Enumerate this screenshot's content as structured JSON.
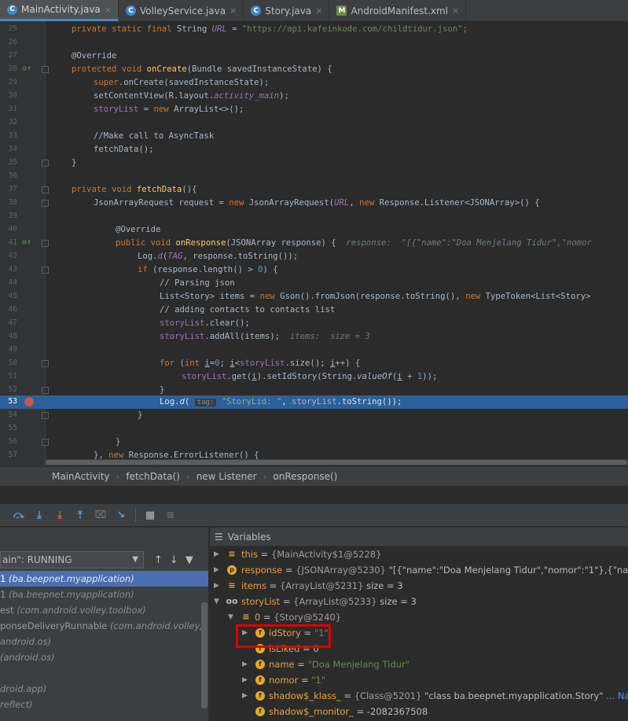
{
  "tabs": [
    {
      "label": "MainActivity.java",
      "icon": "java-class-icon",
      "active": true
    },
    {
      "label": "VolleyService.java",
      "icon": "java-class-icon",
      "active": false
    },
    {
      "label": "Story.java",
      "icon": "java-class-icon",
      "active": false
    },
    {
      "label": "AndroidManifest.xml",
      "icon": "xml-manifest-icon",
      "active": false
    }
  ],
  "code": {
    "line_numbers": [
      "25",
      "26",
      "27",
      "28",
      "29",
      "30",
      "31",
      "32",
      "33",
      "34",
      "35",
      "36",
      "37",
      "38",
      "39",
      "40",
      "41",
      "42",
      "43",
      "44",
      "45",
      "46",
      "47",
      "48",
      "49",
      "50",
      "51",
      "52",
      "53",
      "54",
      "55",
      "56",
      "57"
    ],
    "current_line": "53",
    "l25": {
      "a": "private static final ",
      "b": "String ",
      "c": "URL",
      "d": " = ",
      "e": "\"https://api.kafeinkode.com/childtidur.json\"",
      "f": ";"
    },
    "l27": "@Override",
    "l28": {
      "a": "protected void ",
      "b": "onCreate",
      "c": "(Bundle savedInstanceState) {"
    },
    "l29": {
      "a": "super",
      "b": ".onCreate(savedInstanceState);"
    },
    "l30": {
      "a": "setContentView(R.layout.",
      "b": "activity_main",
      "c": ");"
    },
    "l31": {
      "a": "storyList",
      "b": " = ",
      "c": "new ",
      "d": "ArrayList<>();"
    },
    "l33": "//Make call to AsyncTask",
    "l34": "fetchData();",
    "l35": "}",
    "l37": {
      "a": "private void ",
      "b": "fetchData",
      "c": "(){"
    },
    "l38": {
      "a": "JsonArrayRequest request = ",
      "b": "new ",
      "c": "JsonArrayRequest(",
      "d": "URL",
      "e": ", ",
      "f": "new ",
      "g": "Response.Listener<JSONArray>() {"
    },
    "l40": "@Override",
    "l41": {
      "a": "public void ",
      "b": "onResponse",
      "c": "(JSONArray response) {  ",
      "d": "response:  \"[{\"name\":\"Doa Menjelang Tidur\",\"nomor"
    },
    "l42": {
      "a": "Log.",
      "b": "d",
      "c": "(",
      "d": "TAG",
      "e": ", response.toString());"
    },
    "l43": {
      "a": "if ",
      "b": "(response.length() > ",
      "c": "0",
      "d": ") {"
    },
    "l44": "// Parsing json",
    "l45": {
      "a": "List<Story> items = ",
      "b": "new ",
      "c": "Gson().fromJson(response.toString(), ",
      "d": "new ",
      "e": "TypeToken<List<Story>"
    },
    "l46": "// adding contacts to contacts list",
    "l47": {
      "a": "storyList",
      "b": ".clear();"
    },
    "l48": {
      "a": "storyList",
      "b": ".addAll(items);  ",
      "c": "items:  size = 3"
    },
    "l50": {
      "a": "for ",
      "b": "(",
      "c": "int ",
      "d": "i",
      "e": "=",
      "f": "0",
      "g": "; ",
      "h": "i",
      "i": "<",
      "j": "storyList",
      "k": ".size(); ",
      "l": "i",
      "m": "++) {"
    },
    "l51": {
      "a": "storyList",
      "b": ".get(",
      "c": "i",
      "d": ").setIdStory(String.",
      "e": "valueOf",
      "f": "(",
      "g": "i",
      "h": " + ",
      "i": "1",
      "j": "));"
    },
    "l52": "}",
    "l53": {
      "a": "Log.",
      "b": "d",
      "c": "( ",
      "param": "tag:",
      "d": " \"StoryLid: \"",
      "e": ", ",
      "f": "storyList",
      "g": ".toString());"
    },
    "l54": "}",
    "l56": "}",
    "l57": {
      "a": "}, ",
      "b": "new ",
      "c": "Response.ErrorListener() {"
    }
  },
  "breadcrumb": [
    "MainActivity",
    "fetchData()",
    "new Listener",
    "onResponse()"
  ],
  "debug_toolbar": {
    "buttons": [
      "step-over-icon",
      "step-into-icon",
      "force-step-into-icon",
      "step-out-icon",
      "drop-frame-icon",
      "run-to-cursor-icon",
      "evaluate-expression-icon",
      "trace-icon"
    ]
  },
  "frames": {
    "thread": "ain\": RUNNING",
    "items": [
      {
        "name": "1",
        "pkg": "(ba.beepnet.myapplication)",
        "selected": true
      },
      {
        "name": "1",
        "pkg": "(ba.beepnet.myapplication)",
        "selected": false
      },
      {
        "name": "est",
        "pkg": "(com.android.volley.toolbox)",
        "selected": false
      },
      {
        "name": "ponseDeliveryRunnable",
        "pkg": "(com.android.volley)",
        "selected": false
      },
      {
        "name": "",
        "pkg": "android.os)",
        "selected": false
      },
      {
        "name": "",
        "pkg": "(android.os)",
        "selected": false
      },
      {
        "name": "",
        "pkg": "",
        "selected": false
      },
      {
        "name": "",
        "pkg": "droid.app)",
        "selected": false
      },
      {
        "name": "",
        "pkg": "reflect)",
        "selected": false
      },
      {
        "name": "",
        "pkg": "",
        "selected": false
      }
    ]
  },
  "variables": {
    "header": "Variables",
    "rows": [
      {
        "name": "this",
        "eq": " = ",
        "val": "{MainActivity$1@5228}",
        "extra": ""
      },
      {
        "name": "response",
        "eq": " = ",
        "val": "{JSONArray@5230}",
        "extra": " \"[{\"name\":\"Doa Menjelang Tidur\",\"nomor\":\"1\"},{\"name\":\"Doa B"
      },
      {
        "name": "items",
        "eq": " = ",
        "val": "{ArrayList@5231}",
        "extra": "  size = 3"
      },
      {
        "name": "storyList",
        "eq": " = ",
        "val": "{ArrayList@5233}",
        "extra": "  size = 3"
      },
      {
        "name": "0",
        "eq": " = ",
        "val": "{Story@5240}",
        "extra": ""
      },
      {
        "name": "idStory",
        "eq": " = ",
        "val": "\"1\"",
        "extra": ""
      },
      {
        "name": "isLiked",
        "eq": " = ",
        "val": "0",
        "extra": ""
      },
      {
        "name": "name",
        "eq": " = ",
        "val": "\"Doa Menjelang Tidur\"",
        "extra": ""
      },
      {
        "name": "nomor",
        "eq": " = ",
        "val": "\"1\"",
        "extra": ""
      },
      {
        "name": "shadow$_klass_",
        "eq": " = ",
        "val": "{Class@5201}",
        "extra": " \"class ba.beepnet.myapplication.Story\"",
        "link": "... Navigate"
      },
      {
        "name": "shadow$_monitor_",
        "eq": " = ",
        "val": "-2082367508",
        "extra": ""
      }
    ]
  },
  "colors": {
    "accent": "#4a88c7",
    "selection": "#2d6099",
    "highlight": "#e00000"
  }
}
